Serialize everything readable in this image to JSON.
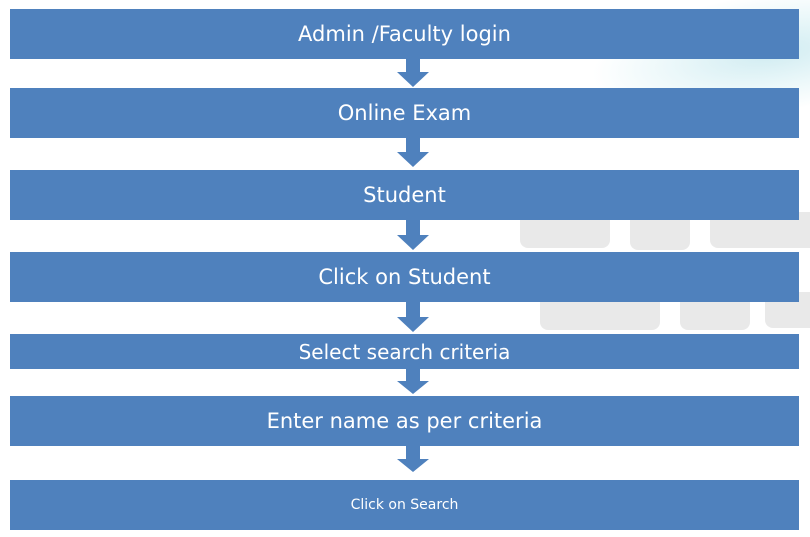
{
  "flowchart": {
    "steps": [
      {
        "label": "Admin /Faculty login"
      },
      {
        "label": "Online Exam"
      },
      {
        "label": "Student"
      },
      {
        "label": "Click on Student"
      },
      {
        "label": "Select search criteria"
      },
      {
        "label": "Enter name as per criteria"
      },
      {
        "label": "Click on Search"
      }
    ]
  },
  "colors": {
    "box_fill": "#4f81bd",
    "arrow_fill": "#4f81bd",
    "text": "#ffffff"
  }
}
